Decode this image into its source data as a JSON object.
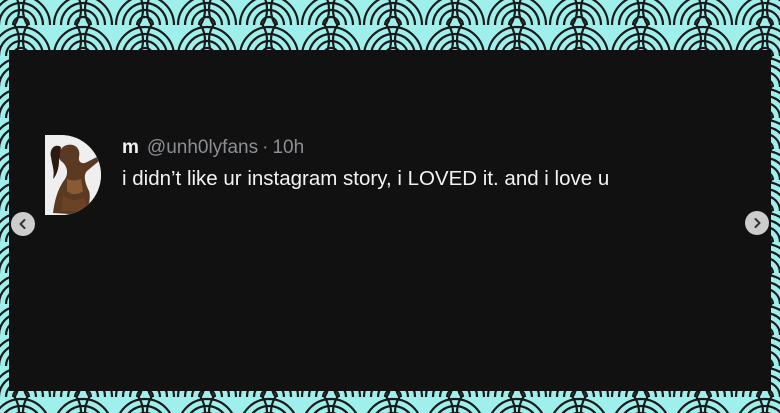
{
  "carousel": {
    "prev_icon": "chevron-left-icon",
    "next_icon": "chevron-right-icon",
    "background_color": "#9ff0ec",
    "pattern_color": "#1a1a1a"
  },
  "tweet": {
    "display_name": "m",
    "handle": "@unh0lyfans",
    "separator": "·",
    "time": "10h",
    "text": "i didn’t like ur instagram story, i LOVED it. and i love u",
    "avatar": "profile-photo"
  },
  "colors": {
    "card_background": "#111111",
    "text_primary": "#f3f3f3",
    "text_secondary": "#8b8f94"
  }
}
